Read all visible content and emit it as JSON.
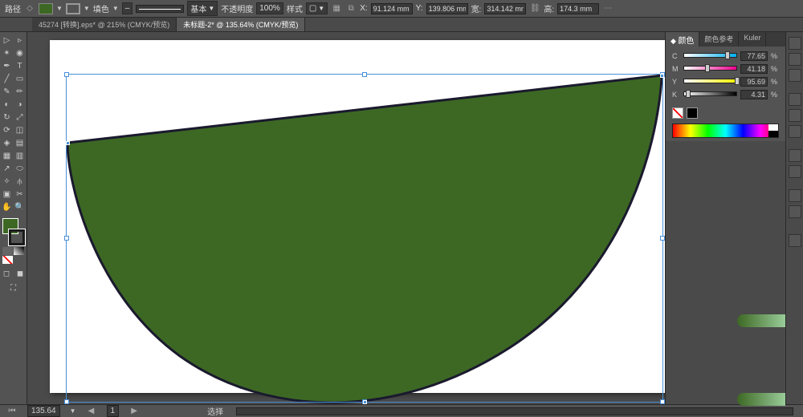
{
  "topbar": {
    "object_type": "路径",
    "fill_label": "填色",
    "stroke_style": "基本",
    "opacity_label": "不透明度",
    "opacity_value": "100%",
    "style_label": "样式",
    "x_label": "X:",
    "x_value": "91.124 mm",
    "y_label": "Y:",
    "y_value": "139.806 mm",
    "w_label": "宽:",
    "w_value": "314.142 mm",
    "h_label": "高:",
    "h_value": "174.3 mm"
  },
  "tabs": [
    {
      "label": "45274 [转换].eps* @ 215% (CMYK/预览)",
      "active": false
    },
    {
      "label": "未标题-2* @ 135.64% (CMYK/预览)",
      "active": true
    }
  ],
  "status": {
    "zoom": "135.64",
    "layer_label": "选择"
  },
  "color_panel": {
    "tab1": "颜色",
    "tab2": "颜色参考",
    "tab3": "Kuler",
    "channels": {
      "c": {
        "label": "C",
        "value": "77.65",
        "suffix": "%"
      },
      "m": {
        "label": "M",
        "value": "41.18",
        "suffix": "%"
      },
      "y": {
        "label": "Y",
        "value": "95.69",
        "suffix": "%"
      },
      "k": {
        "label": "K",
        "value": "4.31",
        "suffix": "%"
      }
    }
  },
  "shape": {
    "fill": "#3d6824",
    "stroke": "#1a1a2e"
  }
}
